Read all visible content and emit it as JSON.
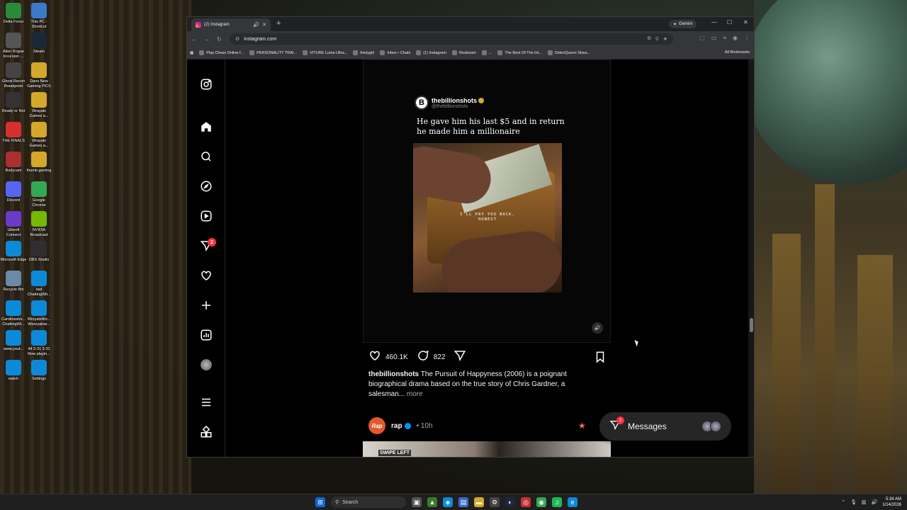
{
  "desktop": {
    "icons": [
      {
        "label": "Delta Force",
        "color": "#2a8a3a"
      },
      {
        "label": "This PC - Shortcut",
        "color": "#3a7ac8"
      },
      {
        "label": "Alien Rogue Incursion ...",
        "color": "#555"
      },
      {
        "label": "Steam",
        "color": "#1b2838"
      },
      {
        "label": "Ghost Recon Breakpoint",
        "color": "#444"
      },
      {
        "label": "Dans New Gaming PICS",
        "color": "#d4a82a"
      },
      {
        "label": "Ready or Not",
        "color": "#333"
      },
      {
        "label": "Wrayals Games a...",
        "color": "#d4a82a"
      },
      {
        "label": "THE FINALS",
        "color": "#d43030"
      },
      {
        "label": "Wrayals Games a...",
        "color": "#d4a82a"
      },
      {
        "label": "Bodycam",
        "color": "#aa3030"
      },
      {
        "label": "thumb gaming",
        "color": "#d4a82a"
      },
      {
        "label": "Discord",
        "color": "#5865f2"
      },
      {
        "label": "Google Chrome",
        "color": "#34a853"
      },
      {
        "label": "Ubisoft Connect",
        "color": "#6a3ac8"
      },
      {
        "label": "NVIDIA Broadcast",
        "color": "#76b900"
      },
      {
        "label": "Microsoft Edge",
        "color": "#0c8ad8"
      },
      {
        "label": "OBS Studio",
        "color": "#302e31"
      },
      {
        "label": "Recycle Bin",
        "color": "#6a8aa8"
      },
      {
        "label": "last ChattingWit...",
        "color": "#0c8ad8"
      },
      {
        "label": "Carolinestor... ChattingWi...",
        "color": "#0c8ad8"
      },
      {
        "label": "WroyalsWo... Wereyalow...",
        "color": "#0c8ad8"
      },
      {
        "label": "www.yout...",
        "color": "#0c8ad8"
      },
      {
        "label": "44 3-31 3-31 Now playin...",
        "color": "#0c8ad8"
      },
      {
        "label": "watch",
        "color": "#0c8ad8"
      },
      {
        "label": "Settings",
        "color": "#0c8ad8"
      }
    ]
  },
  "browser": {
    "tab_title": "(2) Instagram",
    "gemini_label": "Gemini",
    "url": "instagram.com",
    "bookmarks": [
      "Play Chess Online f...",
      "PERSONALITY TRAI...",
      "VITURE Luma Ultra...",
      "feistygirl",
      "Inbox • Chats",
      "(1) Instagram",
      "Restream",
      "...",
      "The Best Of The Int...",
      "DeleriQueen Strea..."
    ],
    "all_bookmarks": "All Bookmarks"
  },
  "instagram": {
    "notification_count": "2",
    "post": {
      "tweet_name": "thebillionshots",
      "tweet_handle": "@thebillionshots",
      "tweet_text": "He gave him his last $5 and in return he made him a millionaire",
      "image_caption_line1": "I'LL PAY YOU BACK,",
      "image_caption_line2": "HONEST",
      "likes": "460.1K",
      "comments": "822",
      "caption_user": "thebillionshots",
      "caption_text": " The Pursuit of Happyness (2006) is a poignant biographical drama based on the true story of Chris Gardner, a salesman...",
      "caption_more": " more"
    },
    "next_post": {
      "user": "rap",
      "time": "10h",
      "avatar_text": "Rap",
      "media_label": "SWIPE LEFT"
    },
    "messages": {
      "label": "Messages",
      "badge": "2"
    }
  },
  "taskbar": {
    "search_label": "Search",
    "time": "5:34 AM",
    "date": "1/14/2026"
  }
}
